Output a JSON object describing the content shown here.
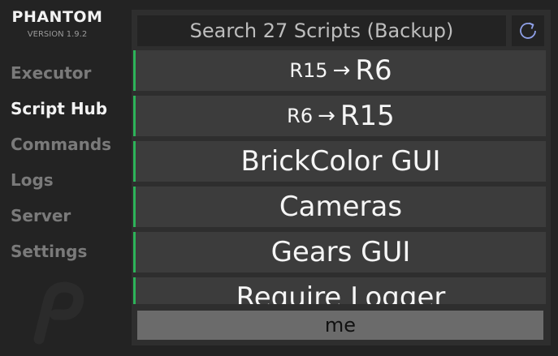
{
  "app": {
    "title": "PHANTOM",
    "version": "VERSION 1.9.2"
  },
  "sidebar": {
    "items": [
      {
        "label": "Executor",
        "active": false
      },
      {
        "label": "Script Hub",
        "active": true
      },
      {
        "label": "Commands",
        "active": false
      },
      {
        "label": "Logs",
        "active": false
      },
      {
        "label": "Server",
        "active": false
      },
      {
        "label": "Settings",
        "active": false
      }
    ]
  },
  "search": {
    "placeholder": "Search 27 Scripts (Backup)",
    "value": ""
  },
  "refresh": {
    "icon": "refresh-icon"
  },
  "scripts": [
    {
      "from": "R15",
      "arrow": "→",
      "to": "R6"
    },
    {
      "from": "R6",
      "arrow": "→",
      "to": "R15"
    },
    {
      "label": "BrickColor GUI"
    },
    {
      "label": "Cameras"
    },
    {
      "label": "Gears GUI"
    },
    {
      "label": "Require Logger"
    }
  ],
  "target": {
    "value": "me"
  },
  "colors": {
    "accent": "#2db359",
    "background": "#232323",
    "panel": "#2e2e2e",
    "item": "#3c3c3c"
  }
}
